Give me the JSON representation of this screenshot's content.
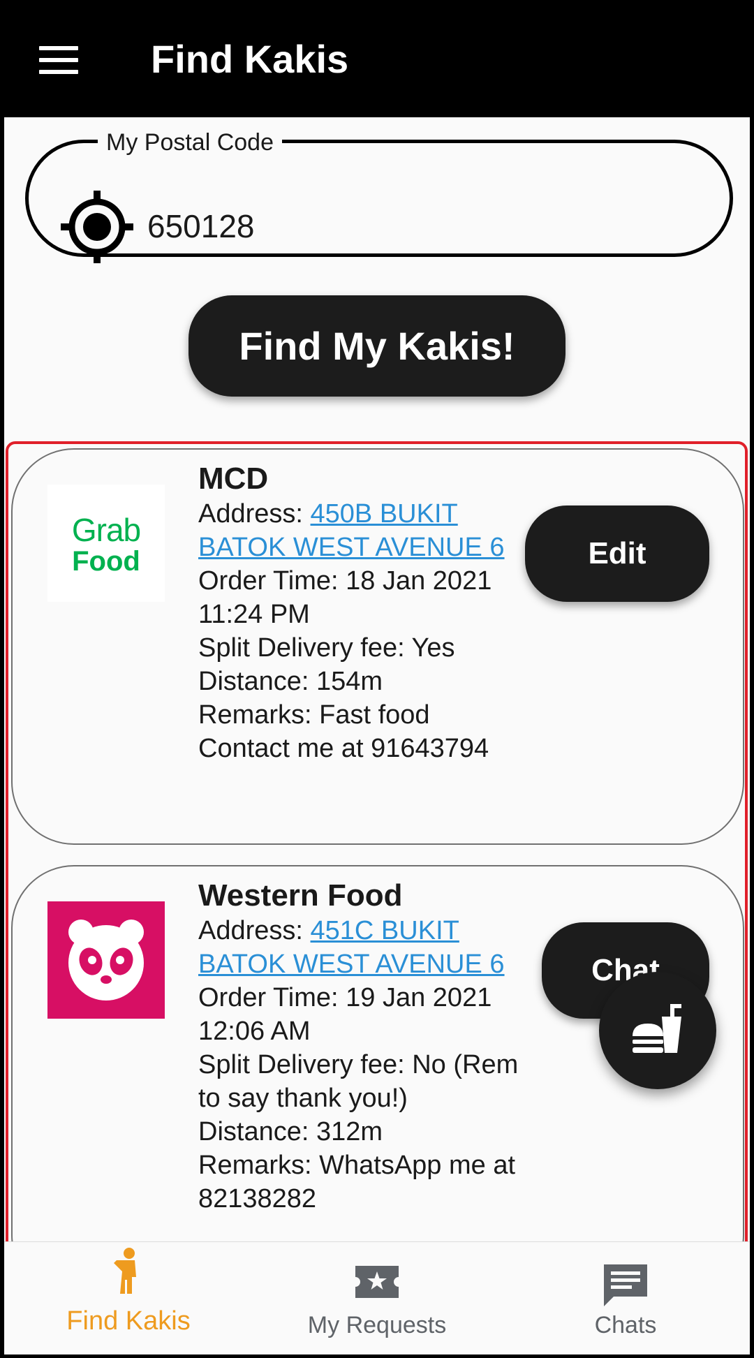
{
  "app_bar": {
    "title": "Find Kakis"
  },
  "postal": {
    "label": "My Postal Code",
    "value": "650128"
  },
  "find_button": {
    "label": "Find My Kakis!"
  },
  "requests": [
    {
      "platform": "GrabFood",
      "logo_text_1": "Grab",
      "logo_text_2": "Food",
      "restaurant": "MCD",
      "address_label": "Address: ",
      "address": "450B BUKIT BATOK WEST AVENUE 6",
      "order_time": "Order Time: 18 Jan 2021 11:24 PM",
      "split_fee": "Split Delivery fee: Yes",
      "distance": "Distance: 154m",
      "remarks": "Remarks: Fast food Contact me at 91643794",
      "action": "Edit"
    },
    {
      "platform": "foodpanda",
      "restaurant": "Western Food",
      "address_label": "Address: ",
      "address": "451C BUKIT BATOK WEST AVENUE 6",
      "order_time": "Order Time: 19 Jan 2021 12:06 AM",
      "split_fee": "Split Delivery fee: No (Rem to say thank you!)",
      "distance": "Distance: 312m",
      "remarks": "Remarks: WhatsApp me at 82138282",
      "action": "Chat"
    }
  ],
  "bottom_nav": {
    "items": [
      {
        "label": "Find Kakis",
        "icon": "person-walking-icon",
        "active": true
      },
      {
        "label": "My Requests",
        "icon": "ticket-star-icon",
        "active": false
      },
      {
        "label": "Chats",
        "icon": "chat-bubble-icon",
        "active": false
      }
    ]
  },
  "colors": {
    "accent": "#ee9b1f",
    "inactive": "#5f6368",
    "link": "#2a8fd6",
    "grab_green": "#00b14f",
    "foodpanda_pink": "#d70f64",
    "highlight": "#e0202a"
  }
}
